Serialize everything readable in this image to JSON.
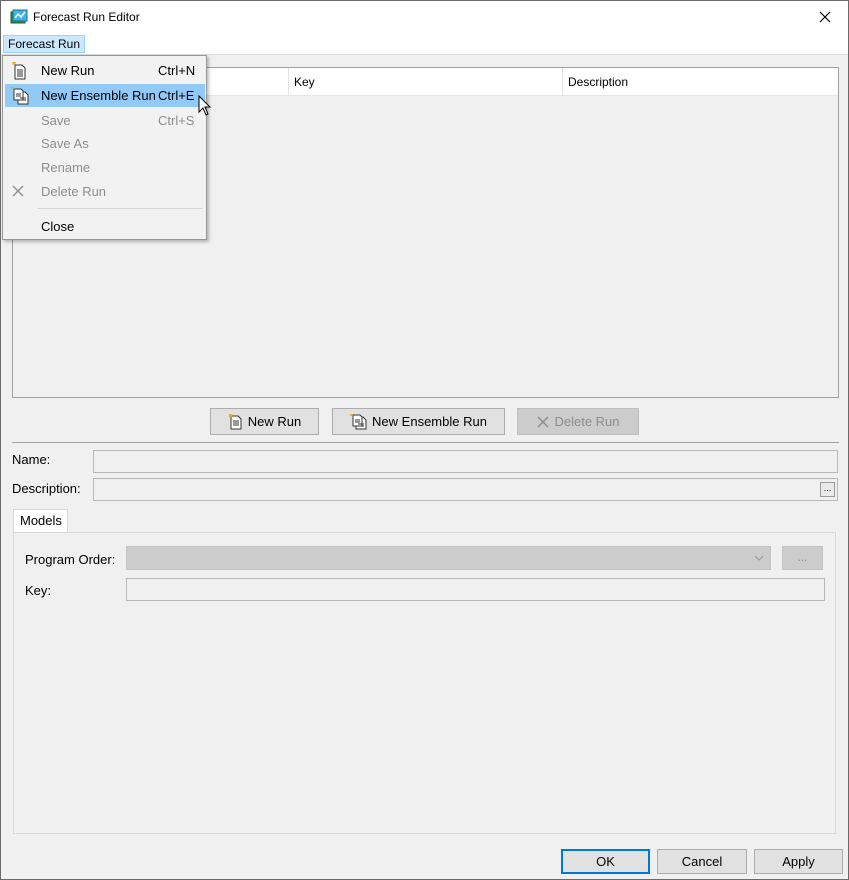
{
  "window": {
    "title": "Forecast Run Editor"
  },
  "menubar": {
    "menu_title": "Forecast Run"
  },
  "menu": {
    "items": [
      {
        "label": "New Run",
        "shortcut": "Ctrl+N",
        "icon": "new-run-icon"
      },
      {
        "label": "New Ensemble Run",
        "shortcut": "Ctrl+E",
        "icon": "new-ensemble-run-icon"
      },
      {
        "label": "Save",
        "shortcut": "Ctrl+S",
        "icon": ""
      },
      {
        "label": "Save As",
        "shortcut": "",
        "icon": ""
      },
      {
        "label": "Rename",
        "shortcut": "",
        "icon": ""
      },
      {
        "label": "Delete Run",
        "shortcut": "",
        "icon": "delete-x-icon"
      },
      {
        "label": "Close",
        "shortcut": "",
        "icon": ""
      }
    ]
  },
  "table": {
    "columns": [
      "",
      "Key",
      "Description"
    ]
  },
  "buttons": {
    "new_run": "New Run",
    "new_ensemble_run": "New Ensemble Run",
    "delete_run": "Delete Run",
    "ok": "OK",
    "cancel": "Cancel",
    "apply": "Apply"
  },
  "form": {
    "name_label": "Name:",
    "name_value": "",
    "description_label": "Description:",
    "description_value": "",
    "description_button": "..."
  },
  "tabs": [
    {
      "label": "Models"
    }
  ],
  "models": {
    "program_order_label": "Program Order:",
    "program_order_value": "",
    "program_order_button": "...",
    "key_label": "Key:",
    "key_value": ""
  },
  "colors": {
    "menu_highlight": "#91c9f7",
    "accent": "#0078d7",
    "background": "#f0f0f0"
  }
}
